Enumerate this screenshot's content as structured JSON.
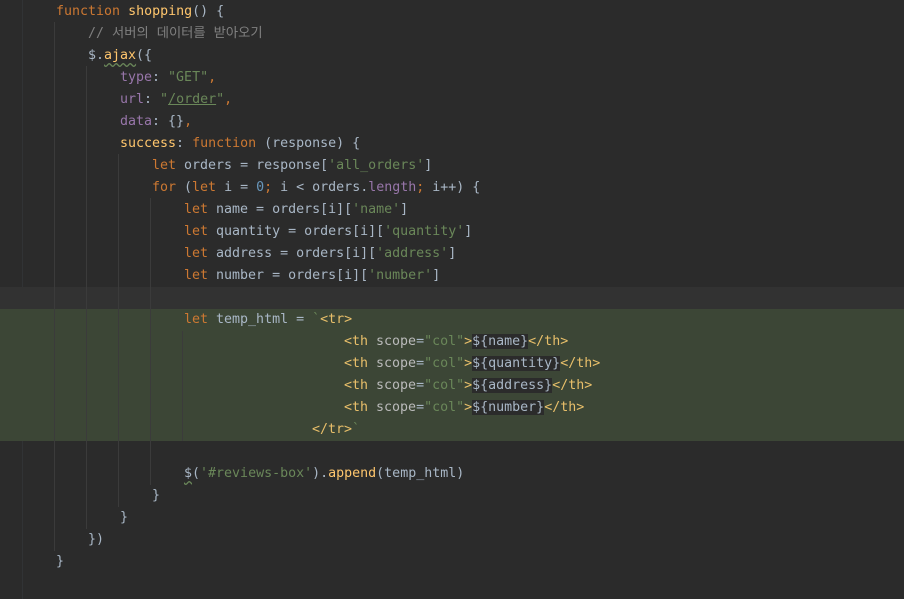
{
  "editor": {
    "colors": {
      "background": "#2b2b2b",
      "caret_line": "#323232",
      "injected_bg": "#3c4636",
      "keyword": "#cc7832",
      "function": "#ffc66d",
      "string": "#6a8759",
      "number": "#6897bb",
      "comment": "#808080",
      "property": "#9876aa",
      "tag": "#e8bf6a",
      "text": "#a9b7c6"
    },
    "lines": [
      {
        "tokens": [
          {
            "t": "kw",
            "v": "function "
          },
          {
            "t": "fn",
            "v": "shopping"
          },
          {
            "t": "def",
            "v": "() {"
          }
        ]
      },
      {
        "tokens": [
          {
            "t": "cmt",
            "v": "// 서버의 데이터를 받아오기"
          }
        ]
      },
      {
        "tokens": [
          {
            "t": "def",
            "v": "$."
          },
          {
            "t": "fn wavy",
            "v": "ajax"
          },
          {
            "t": "def",
            "v": "({"
          }
        ]
      },
      {
        "tokens": [
          {
            "t": "prop",
            "v": "type"
          },
          {
            "t": "def",
            "v": ": "
          },
          {
            "t": "str",
            "v": "\"GET\""
          },
          {
            "t": "kw",
            "v": ","
          }
        ]
      },
      {
        "tokens": [
          {
            "t": "prop",
            "v": "url"
          },
          {
            "t": "def",
            "v": ": "
          },
          {
            "t": "str",
            "v": "\""
          },
          {
            "t": "url",
            "v": "/order"
          },
          {
            "t": "str",
            "v": "\""
          },
          {
            "t": "kw",
            "v": ","
          }
        ]
      },
      {
        "tokens": [
          {
            "t": "prop",
            "v": "data"
          },
          {
            "t": "def",
            "v": ": {}"
          },
          {
            "t": "kw",
            "v": ","
          }
        ]
      },
      {
        "tokens": [
          {
            "t": "fn",
            "v": "success"
          },
          {
            "t": "def",
            "v": ": "
          },
          {
            "t": "kw",
            "v": "function "
          },
          {
            "t": "def",
            "v": "(response) {"
          }
        ]
      },
      {
        "tokens": [
          {
            "t": "kw",
            "v": "let "
          },
          {
            "t": "def",
            "v": "orders = response["
          },
          {
            "t": "str",
            "v": "'all_orders'"
          },
          {
            "t": "def",
            "v": "]"
          }
        ]
      },
      {
        "tokens": [
          {
            "t": "kw",
            "v": "for "
          },
          {
            "t": "def",
            "v": "("
          },
          {
            "t": "kw",
            "v": "let "
          },
          {
            "t": "def",
            "v": "i = "
          },
          {
            "t": "num",
            "v": "0"
          },
          {
            "t": "kw",
            "v": "; "
          },
          {
            "t": "def",
            "v": "i < orders."
          },
          {
            "t": "prop",
            "v": "length"
          },
          {
            "t": "kw",
            "v": "; "
          },
          {
            "t": "def",
            "v": "i++) {"
          }
        ]
      },
      {
        "tokens": [
          {
            "t": "kw",
            "v": "let "
          },
          {
            "t": "def",
            "v": "name = orders[i]["
          },
          {
            "t": "str",
            "v": "'name'"
          },
          {
            "t": "def",
            "v": "]"
          }
        ]
      },
      {
        "tokens": [
          {
            "t": "kw",
            "v": "let "
          },
          {
            "t": "def",
            "v": "quantity = orders[i]["
          },
          {
            "t": "str",
            "v": "'quantity'"
          },
          {
            "t": "def",
            "v": "]"
          }
        ]
      },
      {
        "tokens": [
          {
            "t": "kw",
            "v": "let "
          },
          {
            "t": "def",
            "v": "address = orders[i]["
          },
          {
            "t": "str",
            "v": "'address'"
          },
          {
            "t": "def",
            "v": "]"
          }
        ]
      },
      {
        "tokens": [
          {
            "t": "kw",
            "v": "let "
          },
          {
            "t": "def",
            "v": "number = orders[i]["
          },
          {
            "t": "str",
            "v": "'number'"
          },
          {
            "t": "def",
            "v": "]"
          }
        ]
      },
      {
        "tokens": []
      },
      {
        "tokens": [
          {
            "t": "kw",
            "v": "let "
          },
          {
            "t": "def",
            "v": "temp_html = "
          },
          {
            "t": "tick",
            "v": "`"
          },
          {
            "t": "tag",
            "v": "<tr>"
          }
        ]
      },
      {
        "tokens": [
          {
            "t": "tag",
            "v": "<th "
          },
          {
            "t": "attr",
            "v": "scope"
          },
          {
            "t": "def",
            "v": "="
          },
          {
            "t": "str",
            "v": "\"col\""
          },
          {
            "t": "tag",
            "v": ">"
          },
          {
            "t": "def interp",
            "v": "${name}"
          },
          {
            "t": "tag",
            "v": "</th>"
          }
        ]
      },
      {
        "tokens": [
          {
            "t": "tag",
            "v": "<th "
          },
          {
            "t": "attr",
            "v": "scope"
          },
          {
            "t": "def",
            "v": "="
          },
          {
            "t": "str",
            "v": "\"col\""
          },
          {
            "t": "tag",
            "v": ">"
          },
          {
            "t": "def interp",
            "v": "${quantity}"
          },
          {
            "t": "tag",
            "v": "</th>"
          }
        ]
      },
      {
        "tokens": [
          {
            "t": "tag",
            "v": "<th "
          },
          {
            "t": "attr",
            "v": "scope"
          },
          {
            "t": "def",
            "v": "="
          },
          {
            "t": "str",
            "v": "\"col\""
          },
          {
            "t": "tag",
            "v": ">"
          },
          {
            "t": "def interp",
            "v": "${address}"
          },
          {
            "t": "tag",
            "v": "</th>"
          }
        ]
      },
      {
        "tokens": [
          {
            "t": "tag",
            "v": "<th "
          },
          {
            "t": "attr",
            "v": "scope"
          },
          {
            "t": "def",
            "v": "="
          },
          {
            "t": "str",
            "v": "\"col\""
          },
          {
            "t": "tag",
            "v": ">"
          },
          {
            "t": "def interp",
            "v": "${number}"
          },
          {
            "t": "tag",
            "v": "</th>"
          }
        ]
      },
      {
        "tokens": [
          {
            "t": "tag",
            "v": "</tr>"
          },
          {
            "t": "tick",
            "v": "`"
          }
        ]
      },
      {
        "tokens": []
      },
      {
        "tokens": [
          {
            "t": "def wavy",
            "v": "$"
          },
          {
            "t": "def",
            "v": "("
          },
          {
            "t": "str",
            "v": "'#reviews-box'"
          },
          {
            "t": "def",
            "v": ")."
          },
          {
            "t": "fn",
            "v": "append"
          },
          {
            "t": "def",
            "v": "(temp_html)"
          }
        ]
      },
      {
        "tokens": [
          {
            "t": "def",
            "v": "}"
          }
        ]
      },
      {
        "tokens": [
          {
            "t": "def",
            "v": "}"
          }
        ]
      },
      {
        "tokens": [
          {
            "t": "def",
            "v": "})"
          }
        ]
      },
      {
        "tokens": [
          {
            "t": "def",
            "v": "}"
          }
        ]
      }
    ]
  }
}
